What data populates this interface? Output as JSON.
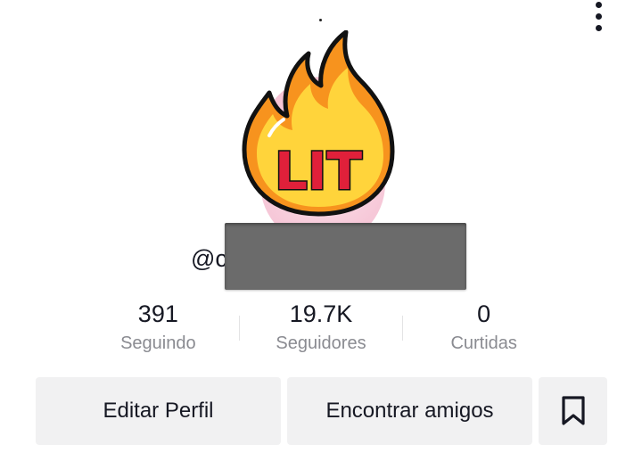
{
  "profile": {
    "sticker_text": "LIT",
    "handle_visible": "@c",
    "stats": [
      {
        "value": "391",
        "label": "Seguindo"
      },
      {
        "value": "19.7K",
        "label": "Seguidores"
      },
      {
        "value": "0",
        "label": "Curtidas"
      }
    ]
  },
  "buttons": {
    "edit_profile": "Editar Perfil",
    "find_friends": "Encontrar amigos"
  },
  "icons": {
    "more": "more-vertical-icon",
    "bookmark": "bookmark-icon"
  },
  "colors": {
    "flame_outer": "#F7931E",
    "flame_inner": "#FFD43B",
    "lit_text": "#E0203A",
    "redaction": "#6B6B6B"
  }
}
